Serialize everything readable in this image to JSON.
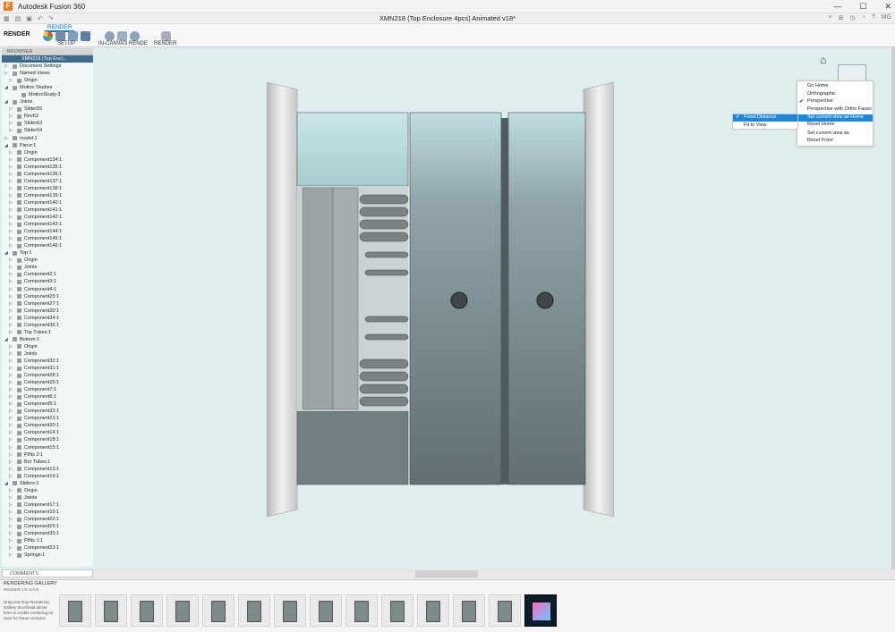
{
  "window": {
    "app_title": "Autodesk Fusion 360",
    "document_title": "XMN218 (Top Enclosure 4pcs) Animated v18*",
    "logo_letter": "F",
    "user_initials": "MG"
  },
  "toolbar": {
    "workspace": "RENDER",
    "active_tab": "RENDER",
    "setup_label": "SETUP",
    "in_canvas_label": "IN-CANVAS RENDE",
    "render_label": "RENDER"
  },
  "browser": {
    "header": "BROWSER",
    "root": "XMN218 (Top Encl...",
    "rows": [
      {
        "label": "Document Settings",
        "indent": 1,
        "arrow": "▷"
      },
      {
        "label": "Named Views",
        "indent": 1,
        "arrow": "▷"
      },
      {
        "label": "Origin",
        "indent": 2,
        "arrow": "▷"
      },
      {
        "label": "Motion Studies",
        "indent": 1,
        "arrow": "◢"
      },
      {
        "label": "MotionStudy-3",
        "indent": 3,
        "arrow": ""
      },
      {
        "label": "Joints",
        "indent": 1,
        "arrow": "◢"
      },
      {
        "label": "Slider55",
        "indent": 2,
        "arrow": "▷"
      },
      {
        "label": "Rev62",
        "indent": 2,
        "arrow": "▷"
      },
      {
        "label": "Slider63",
        "indent": 2,
        "arrow": "▷"
      },
      {
        "label": "Slider64",
        "indent": 2,
        "arrow": "▷"
      },
      {
        "label": "model:1",
        "indent": 1,
        "arrow": "▷"
      },
      {
        "label": "Piece:1",
        "indent": 1,
        "arrow": "◢"
      },
      {
        "label": "Origin",
        "indent": 2,
        "arrow": "▷"
      },
      {
        "label": "Component134:1",
        "indent": 2,
        "arrow": "▷"
      },
      {
        "label": "Component135:1",
        "indent": 2,
        "arrow": "▷"
      },
      {
        "label": "Component136:1",
        "indent": 2,
        "arrow": "▷"
      },
      {
        "label": "Component137:1",
        "indent": 2,
        "arrow": "▷"
      },
      {
        "label": "Component138:1",
        "indent": 2,
        "arrow": "▷"
      },
      {
        "label": "Component139:1",
        "indent": 2,
        "arrow": "▷"
      },
      {
        "label": "Component140:1",
        "indent": 2,
        "arrow": "▷"
      },
      {
        "label": "Component141:1",
        "indent": 2,
        "arrow": "▷"
      },
      {
        "label": "Component142:1",
        "indent": 2,
        "arrow": "▷"
      },
      {
        "label": "Component143:1",
        "indent": 2,
        "arrow": "▷"
      },
      {
        "label": "Component144:1",
        "indent": 2,
        "arrow": "▷"
      },
      {
        "label": "Component145:1",
        "indent": 2,
        "arrow": "▷"
      },
      {
        "label": "Component146:1",
        "indent": 2,
        "arrow": "▷"
      },
      {
        "label": "Top:1",
        "indent": 1,
        "arrow": "◢"
      },
      {
        "label": "Origin",
        "indent": 2,
        "arrow": "▷"
      },
      {
        "label": "Joints",
        "indent": 2,
        "arrow": "▷"
      },
      {
        "label": "Component2:1",
        "indent": 2,
        "arrow": "▷"
      },
      {
        "label": "Component3:1",
        "indent": 2,
        "arrow": "▷"
      },
      {
        "label": "Component4:1",
        "indent": 2,
        "arrow": "▷"
      },
      {
        "label": "Component25:1",
        "indent": 2,
        "arrow": "▷"
      },
      {
        "label": "Component27:1",
        "indent": 2,
        "arrow": "▷"
      },
      {
        "label": "Component30:1",
        "indent": 2,
        "arrow": "▷"
      },
      {
        "label": "Component34:1",
        "indent": 2,
        "arrow": "▷"
      },
      {
        "label": "Component36:1",
        "indent": 2,
        "arrow": "▷"
      },
      {
        "label": "Top Tubes:1",
        "indent": 2,
        "arrow": "▷"
      },
      {
        "label": "Bottom:1",
        "indent": 1,
        "arrow": "◢"
      },
      {
        "label": "Origin",
        "indent": 2,
        "arrow": "▷"
      },
      {
        "label": "Joints",
        "indent": 2,
        "arrow": "▷"
      },
      {
        "label": "Component32:1",
        "indent": 2,
        "arrow": "▷"
      },
      {
        "label": "Component31:1",
        "indent": 2,
        "arrow": "▷"
      },
      {
        "label": "Component28:1",
        "indent": 2,
        "arrow": "▷"
      },
      {
        "label": "Component26:1",
        "indent": 2,
        "arrow": "▷"
      },
      {
        "label": "Component7:1",
        "indent": 2,
        "arrow": "▷"
      },
      {
        "label": "Component6:1",
        "indent": 2,
        "arrow": "▷"
      },
      {
        "label": "Component5:1",
        "indent": 2,
        "arrow": "▷"
      },
      {
        "label": "Component33:1",
        "indent": 2,
        "arrow": "▷"
      },
      {
        "label": "Component21:1",
        "indent": 2,
        "arrow": "▷"
      },
      {
        "label": "Component20:1",
        "indent": 2,
        "arrow": "▷"
      },
      {
        "label": "Component14:1",
        "indent": 2,
        "arrow": "▷"
      },
      {
        "label": "Component18:1",
        "indent": 2,
        "arrow": "▷"
      },
      {
        "label": "Component15:1",
        "indent": 2,
        "arrow": "▷"
      },
      {
        "label": "PINs 2:1",
        "indent": 2,
        "arrow": "▷"
      },
      {
        "label": "Bot Tubes:1",
        "indent": 2,
        "arrow": "▷"
      },
      {
        "label": "Component13:1",
        "indent": 2,
        "arrow": "▷"
      },
      {
        "label": "Component19:1",
        "indent": 2,
        "arrow": "▷"
      },
      {
        "label": "Sliders:1",
        "indent": 1,
        "arrow": "◢"
      },
      {
        "label": "Origin",
        "indent": 2,
        "arrow": "▷"
      },
      {
        "label": "Joints",
        "indent": 2,
        "arrow": "▷"
      },
      {
        "label": "Component17:1",
        "indent": 2,
        "arrow": "▷"
      },
      {
        "label": "Component16:1",
        "indent": 2,
        "arrow": "▷"
      },
      {
        "label": "Component22:1",
        "indent": 2,
        "arrow": "▷"
      },
      {
        "label": "Component29:1",
        "indent": 2,
        "arrow": "▷"
      },
      {
        "label": "Component35:1",
        "indent": 2,
        "arrow": "▷"
      },
      {
        "label": "PINs 1:1",
        "indent": 2,
        "arrow": "▷"
      },
      {
        "label": "Component23:1",
        "indent": 2,
        "arrow": "▷"
      },
      {
        "label": "Springs:1",
        "indent": 2,
        "arrow": "▷"
      }
    ]
  },
  "view_menu": {
    "items": [
      "Go Home",
      "Orthographic",
      "Perspective",
      "Perspective with Ortho Faces",
      "Set current view as Home",
      "Reset Home",
      "Set current view as",
      "Reset Front"
    ],
    "checked": "Perspective",
    "highlighted": "Set current view as Home",
    "submenu": [
      "Fixed Distance",
      "Fit to View"
    ],
    "submenu_checked": "Fixed Distance"
  },
  "comments": {
    "label": "COMMENTS"
  },
  "gallery": {
    "title": "RENDERING GALLERY",
    "subtitle": "RENDER ON SAVE",
    "help": "Drag and drop Rendering Gallery thumbnail above here to enable rendering on save for future versions",
    "thumb_count": 14
  },
  "colors": {
    "accent": "#0a7ac8",
    "viewport": "#dfedee",
    "highlight": "#1e88d8"
  }
}
